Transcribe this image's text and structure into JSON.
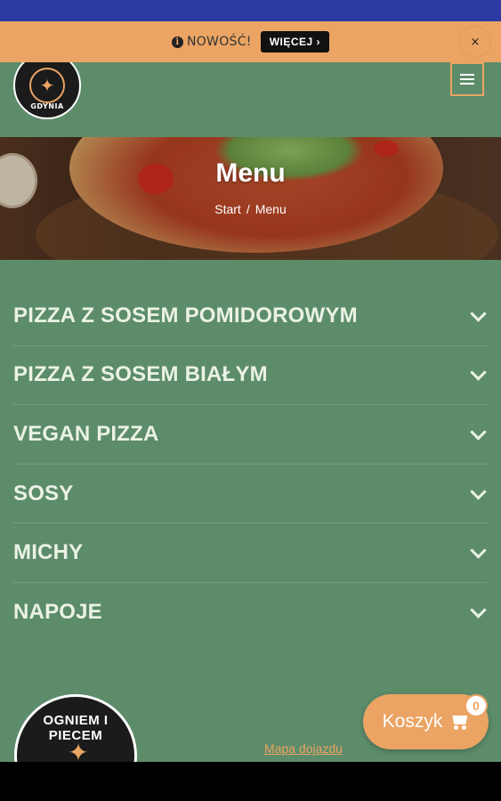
{
  "notice": {
    "text": "NOWOŚĆ!",
    "more_label": "WIĘCEJ ›",
    "close_label": "×"
  },
  "header": {
    "logo_text": "GDYNIA"
  },
  "hero": {
    "title": "Menu",
    "breadcrumb": {
      "home": "Start",
      "separator": "/",
      "current": "Menu"
    }
  },
  "categories": [
    {
      "label": "PIZZA Z SOSEM POMIDOROWYM"
    },
    {
      "label": "PIZZA Z SOSEM BIAŁYM"
    },
    {
      "label": "VEGAN PIZZA"
    },
    {
      "label": "SOSY"
    },
    {
      "label": "MICHY"
    },
    {
      "label": "NAPOJE"
    }
  ],
  "footer": {
    "logo_text": "OGNIEM I PIECEM",
    "map_link": "Mapa dojazdu"
  },
  "cart": {
    "label": "Koszyk",
    "count": "0"
  },
  "colors": {
    "status_bar": "#2c3aa3",
    "accent": "#eba463",
    "page_bg": "#5d8c6a",
    "text_light": "#eaf2e5"
  }
}
